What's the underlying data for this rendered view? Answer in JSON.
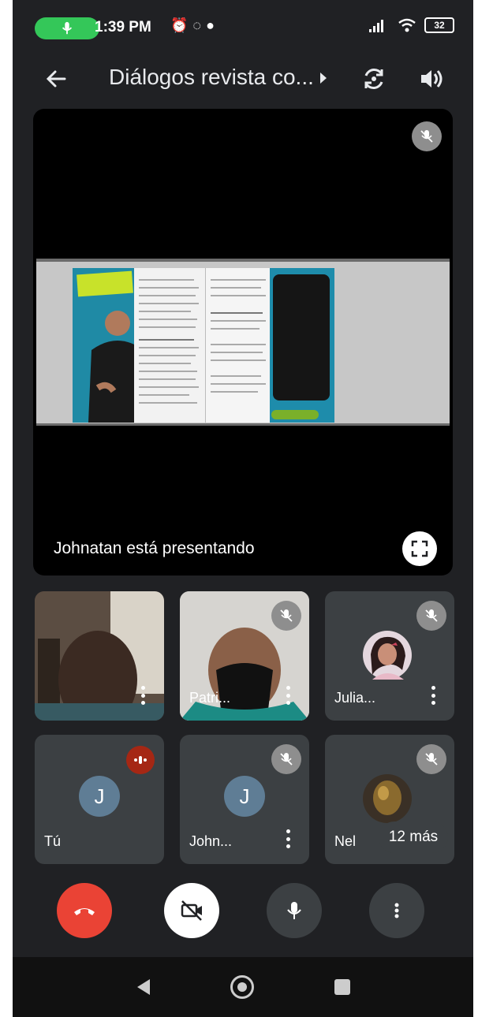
{
  "status_bar": {
    "time": "1:39 PM",
    "battery": "32"
  },
  "header": {
    "title": "Diálogos revista co..."
  },
  "main_stage": {
    "presenting_label": "Johnatan está presentando"
  },
  "participants": [
    {
      "name": "",
      "muted": false
    },
    {
      "name": "Patri...",
      "muted": true
    },
    {
      "name": "Julia...",
      "muted": true
    },
    {
      "name": "Tú",
      "avatar_letter": "J",
      "speaking": true
    },
    {
      "name": "John...",
      "avatar_letter": "J",
      "muted": true
    },
    {
      "name": "Nel",
      "muted": true
    }
  ],
  "more_chip": "12 más",
  "colors": {
    "background": "#202124",
    "tile": "#3c4043",
    "end_call": "#ea4335",
    "status_pill": "#34c759"
  }
}
